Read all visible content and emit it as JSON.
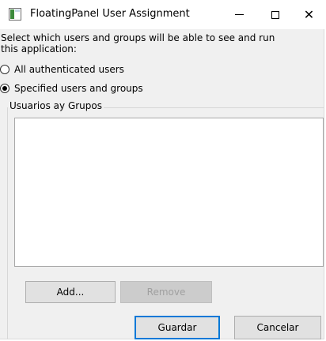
{
  "window": {
    "title": "FloatingPanel User Assignment",
    "minimize_icon": "minimize-icon",
    "maximize_icon": "maximize-icon",
    "close_icon": "close-icon",
    "close_glyph": "✕"
  },
  "description": "Select which users and groups will be able to see and run this application:",
  "options": {
    "all_users": {
      "label": "All authenticated users",
      "selected": false
    },
    "specified": {
      "label": "Specified users and groups",
      "selected": true
    }
  },
  "group": {
    "legend": "Usuarios ay Grupos",
    "list_items": []
  },
  "buttons": {
    "add": "Add...",
    "remove": "Remove",
    "save": "Guardar",
    "cancel": "Cancelar"
  },
  "colors": {
    "dialog_bg": "#f0f0f0",
    "default_button_border": "#0078d7",
    "disabled_text": "#a0a0a0"
  }
}
